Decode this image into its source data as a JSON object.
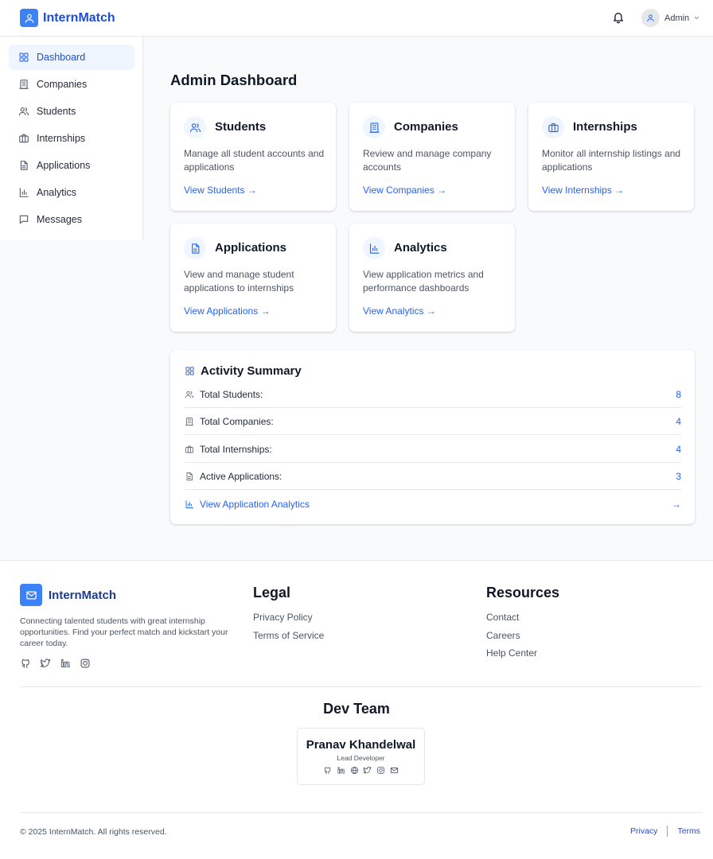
{
  "app": {
    "name": "InternMatch"
  },
  "header": {
    "user_name": "Admin"
  },
  "sidebar": {
    "items": [
      {
        "label": "Dashboard",
        "icon": "dashboard-icon",
        "active": true
      },
      {
        "label": "Companies",
        "icon": "building-icon"
      },
      {
        "label": "Students",
        "icon": "users-icon"
      },
      {
        "label": "Internships",
        "icon": "briefcase-icon"
      },
      {
        "label": "Applications",
        "icon": "document-icon"
      },
      {
        "label": "Analytics",
        "icon": "bar-chart-icon"
      },
      {
        "label": "Messages",
        "icon": "message-icon"
      }
    ]
  },
  "main": {
    "title": "Admin Dashboard",
    "cards": [
      {
        "title": "Students",
        "desc": "Manage all student accounts and applications",
        "link": "View Students →",
        "icon": "users-icon"
      },
      {
        "title": "Companies",
        "desc": "Review and manage company accounts",
        "link": "View Companies →",
        "icon": "building-icon"
      },
      {
        "title": "Internships",
        "desc": "Monitor all internship listings and applications",
        "link": "View Internships →",
        "icon": "briefcase-icon"
      },
      {
        "title": "Applications",
        "desc": "View and manage student applications to internships",
        "link": "View Applications →",
        "icon": "document-icon"
      },
      {
        "title": "Analytics",
        "desc": "View application metrics and performance dashboards",
        "link": "View Analytics →",
        "icon": "bar-chart-icon"
      }
    ],
    "summary": {
      "title": "Activity Summary",
      "rows": [
        {
          "label": "Total Students:",
          "value": "8"
        },
        {
          "label": "Total Companies:",
          "value": "4"
        },
        {
          "label": "Total Internships:",
          "value": "4"
        },
        {
          "label": "Active Applications:",
          "value": "3"
        }
      ],
      "link_label": "View Application Analytics",
      "link_arrow": "→"
    }
  },
  "footer": {
    "brand": "InternMatch",
    "tagline": "Connecting talented students with great internship opportunities. Find your perfect match and kickstart your career today.",
    "legal_title": "Legal",
    "legal_links": [
      "Privacy Policy",
      "Terms of Service"
    ],
    "resources_title": "Resources",
    "resources_links": [
      "Contact",
      "Careers",
      "Help Center"
    ],
    "dev_title": "Dev Team",
    "dev": {
      "name": "Pranav Khandelwal",
      "role": "Lead Developer"
    },
    "copyright": "© 2025 InternMatch. All rights reserved.",
    "bottom_links": [
      "Privacy",
      "Terms"
    ]
  },
  "colors": {
    "accent": "#2563eb",
    "brand": "#3b82f6"
  }
}
